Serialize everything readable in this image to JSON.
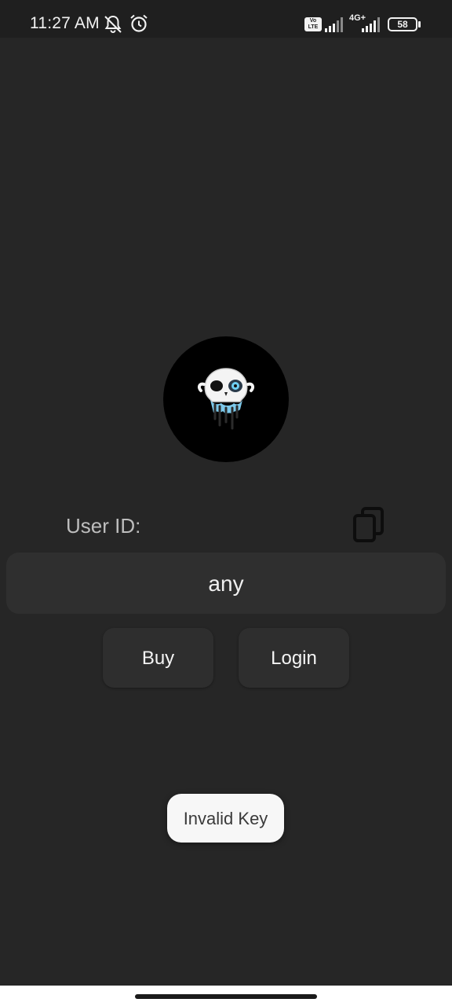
{
  "status_bar": {
    "time": "11:27 AM",
    "volte": "Vo LTE",
    "network": "4G+",
    "battery": "58",
    "icons": [
      "dnd-icon",
      "alarm-icon",
      "signal-icon",
      "battery-icon"
    ]
  },
  "logo": {
    "icon": "skull-logo-icon"
  },
  "form": {
    "user_id_label": "User ID:",
    "copy_icon": "copy-icon",
    "key_value": "any"
  },
  "buttons": {
    "buy": "Buy",
    "login": "Login"
  },
  "toast": {
    "message": "Invalid Key"
  },
  "colors": {
    "background": "#262626",
    "field": "#2f2f2f",
    "button": "#2e2e2e",
    "toast": "#f7f7f7"
  }
}
